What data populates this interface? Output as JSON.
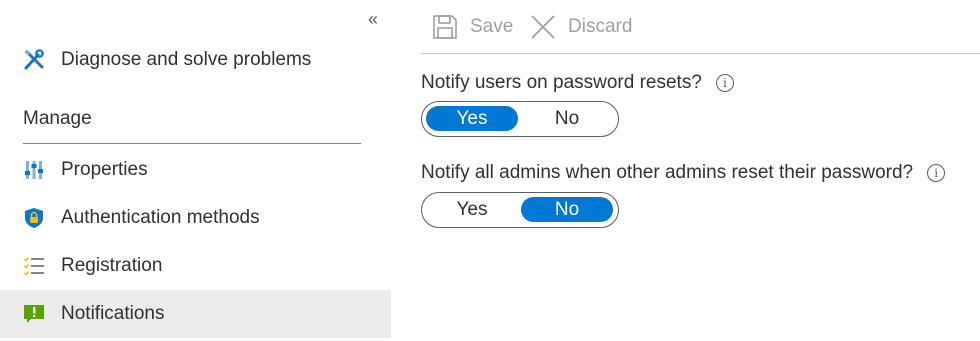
{
  "sidebar": {
    "collapse_glyph": "«",
    "items_top": [
      {
        "label": "Diagnose and solve problems",
        "icon": "wrench-screwdriver-icon"
      }
    ],
    "section_header": "Manage",
    "items": [
      {
        "label": "Properties",
        "icon": "sliders-icon"
      },
      {
        "label": "Authentication methods",
        "icon": "shield-lock-icon"
      },
      {
        "label": "Registration",
        "icon": "checklist-icon"
      },
      {
        "label": "Notifications",
        "icon": "notification-icon",
        "active": true
      }
    ]
  },
  "toolbar": {
    "save_label": "Save",
    "discard_label": "Discard"
  },
  "settings": [
    {
      "question": "Notify users on password resets?",
      "info": "i",
      "options": [
        "Yes",
        "No"
      ],
      "selected": "Yes"
    },
    {
      "question": "Notify all admins when other admins reset their password?",
      "info": "i",
      "options": [
        "Yes",
        "No"
      ],
      "selected": "No"
    }
  ],
  "colors": {
    "accent": "#0078d4",
    "active_item_bg": "#edebe9",
    "disabled_text": "#a19f9d"
  }
}
